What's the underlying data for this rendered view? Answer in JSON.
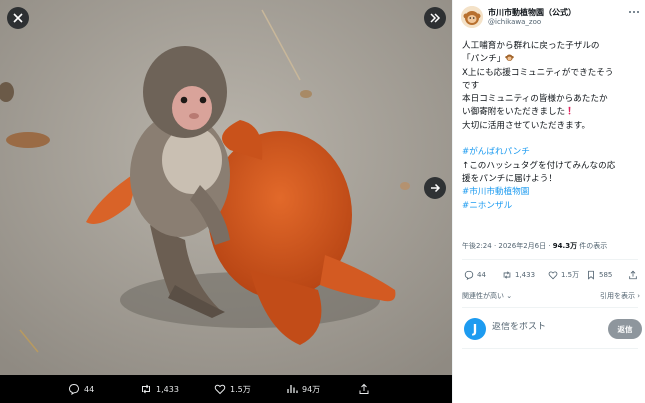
{
  "media": {
    "close_icon": "close-icon",
    "expand_icon": "double-chevron-right-icon",
    "next_icon": "arrow-right-icon",
    "bar": {
      "replies": "44",
      "reposts": "1,433",
      "likes": "1.5万",
      "views": "94万"
    }
  },
  "tweet": {
    "display_name": "市川市動植物園（公式）",
    "handle": "@ichikawa_zoo",
    "lines": [
      "人工哺育から群れに戻った子ザルの",
      "「パンチ」",
      "X上にも応援コミュニティができたそう",
      "です",
      "本日コミュニティの皆様からあたたか",
      "い御寄附をいただきました",
      "大切に活用させていただきます。"
    ],
    "hashtag_1": "#がんばれパンチ",
    "text_2": "↑このハッシュタグを付けてみんなの応",
    "text_3": "援をパンチに届けよう！",
    "hashtag_2": "#市川市動植物園",
    "hashtag_3": "#ニホンザル",
    "time": "午後2:24 · 2026年2月6日 · ",
    "views_count": "94.3万",
    "views_suffix": " 件の表示"
  },
  "actions": {
    "replies": "44",
    "reposts": "1,433",
    "likes": "1.5万",
    "bookmarks": "585"
  },
  "sort": {
    "left": "関連性が高い",
    "right": "引用を表示"
  },
  "reply": {
    "avatar_letter": "J",
    "placeholder": "返信をポスト",
    "button": "返信"
  },
  "colors": {
    "accent": "#1d9bf0",
    "text": "#0f1419",
    "muted": "#536471",
    "reply_button": "#8e969d"
  }
}
